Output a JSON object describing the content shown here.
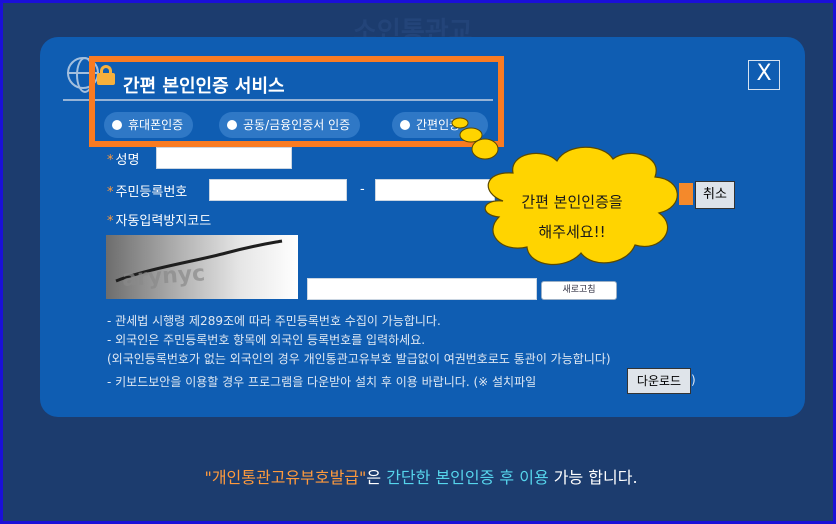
{
  "background": {
    "ghost_title": "소인통관교",
    "ghost_right": "터"
  },
  "modal": {
    "title": "간편 본인인증 서비스",
    "close_label": "X",
    "auth_options": [
      {
        "label": "휴대폰인증"
      },
      {
        "label": "공동/금융인증서 인증"
      },
      {
        "label": "간편인증"
      }
    ]
  },
  "form": {
    "name_label": "성명",
    "rrn_label": "주민등록번호",
    "rrn_separator": "-",
    "cancel_label": "취소",
    "captcha_label": "자동입력방지코드",
    "refresh_label": "새로고침",
    "required_mark": "*"
  },
  "notes": [
    "- 관세법 시행령 제289조에 따라 주민등록번호 수집이 가능합니다.",
    "- 외국인은 주민등록번호 항목에 외국인 등록번호를 입력하세요.",
    "(외국인등록번호가 없는 외국인의 경우 개인통관고유부호 발급없이 여권번호로도 통관이 가능합니다)",
    "- 키보드보안을 이용할 경우 프로그램을 다운받아 설치 후 이용 바랍니다. (※ 설치파일"
  ],
  "download_label": "다운로드",
  "close_paren": ")",
  "callout": {
    "line1": "간편  본인인증을",
    "line2": "해주세요!!"
  },
  "footer": {
    "part1": "\"개인통관고유부호발급\"",
    "part2": "은 ",
    "part3": "간단한 본인인증 후 이용",
    "part4": " 가능 합니다."
  },
  "colors": {
    "frame_border": "#1a10d8",
    "backdrop": "#1c3c6e",
    "modal": "#0f5db2",
    "highlight": "#f97b22",
    "callout_fill": "#ffd400",
    "footer_orange": "#ff9a3c",
    "footer_cyan": "#56d5ec"
  }
}
